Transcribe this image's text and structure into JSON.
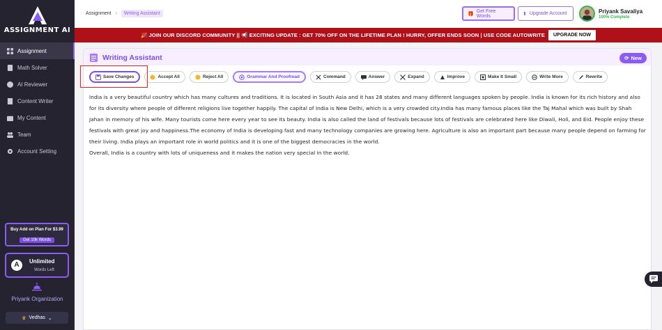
{
  "app": {
    "logo_text": "ASSIGNMENT AI",
    "accent": "#8a5cf6",
    "sidebar_bg": "#24232f"
  },
  "sidebar": {
    "items": [
      {
        "label": "Assignment",
        "icon": "grid-icon",
        "active": true
      },
      {
        "label": "Math Solver",
        "icon": "calculator-icon"
      },
      {
        "label": "AI Reviewer",
        "icon": "info-icon"
      },
      {
        "label": "Content Writer",
        "icon": "document-icon"
      },
      {
        "label": "My Content",
        "icon": "folder-icon"
      },
      {
        "label": "Team",
        "icon": "team-icon"
      },
      {
        "label": "Account Setting",
        "icon": "gear-icon"
      }
    ],
    "addon_title": "Buy Add on Plan For $3.99",
    "addon_button": "Get 10k Words",
    "plan_title": "Unlimited",
    "plan_subtitle": "Words Left",
    "plan_badge": "A",
    "org_name": "Priyank Organization",
    "workspace": "Vedhas"
  },
  "header": {
    "breadcrumb_root": "Assignment",
    "breadcrumb_current": "Writing Assistant",
    "free_words_label": "Get Free Words",
    "upgrade_label": "Upgrade Account",
    "user_name": "Priyank Savaliya",
    "user_progress": "100% Complete"
  },
  "banner": {
    "text": "🎉 JOIN OUR DISCORD COMMUNITY || 📢 EXCITING UPDATE : GET 70% OFF ON THE LIFETIME PLAN ! HURRY, OFFER ENDS SOON | USE CODE AUTOWRITE",
    "button": "UPGRADE NOW",
    "color": "#b01119"
  },
  "panel": {
    "title": "Writing Assistant",
    "new_label": "New",
    "toolbar": {
      "save": "Save Changes",
      "accept": "Accept All",
      "reject": "Reject All",
      "grammar": "Grammar And Proofread",
      "command": "Command",
      "answer": "Answer",
      "expand": "Expand",
      "improve": "Improve",
      "make_small": "Make It Small",
      "write_more": "Write More",
      "rewrite": "Rewrite"
    },
    "content": {
      "p1": "India is a very beautiful country which has many cultures and traditions. It is located in South Asia and it has 28 states and many different languages spoken by people. India is known for its rich history and also for its diversity where people of different religions live together happily. The capital of India is New Delhi, which is a very crowded city.India has many famous places like the Taj Mahal which was built by Shah Jahan in memory of his wife. Many tourists come here every year to see its beauty. India is also called the land of festivals because lots of festivals are celebrated here like Diwali, Holi, and Eid. People enjoy these festivals with great joy and happiness.The economy of India is developing fast and many technology companies are growing here. Agriculture is also an important part because many people depend on farming for their living. India plays an important role in world politics and it is one of the biggest democracies in the world.",
      "p2": "Overall, India is a country with lots of uniqueness and it makes the nation very special in the world."
    }
  }
}
